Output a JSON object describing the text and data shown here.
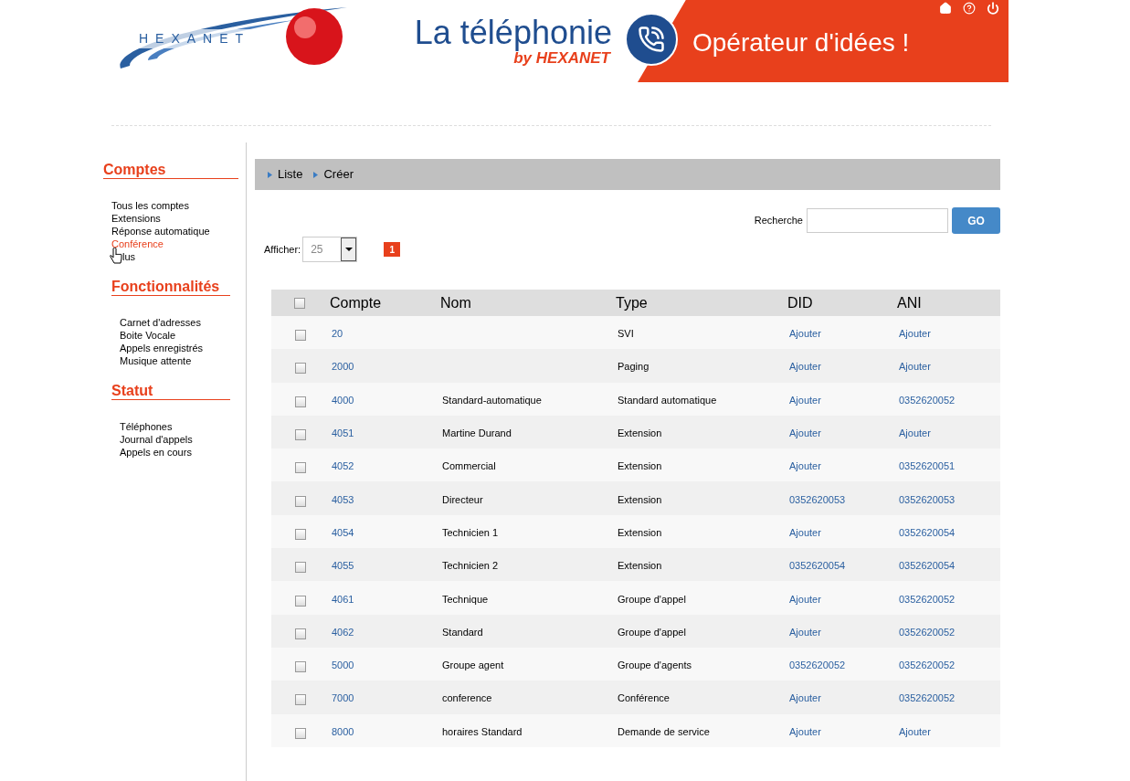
{
  "header": {
    "logo": "HEXANET",
    "banner_title": "La téléphonie",
    "banner_by": "by HEXANET",
    "banner_slogan": "Opérateur d'idées !"
  },
  "sidebar": {
    "sections": [
      {
        "title": "Comptes",
        "items": [
          {
            "label": "Tous les comptes",
            "selected": false
          },
          {
            "label": "Extensions",
            "selected": false
          },
          {
            "label": "Réponse automatique",
            "selected": false
          },
          {
            "label": "Conférence",
            "selected": true
          },
          {
            "label": "lus",
            "selected": false,
            "cursor": true
          }
        ]
      },
      {
        "title": "Fonctionnalités",
        "items": [
          {
            "label": "Carnet d'adresses",
            "selected": false
          },
          {
            "label": "Boite Vocale",
            "selected": false
          },
          {
            "label": "Appels enregistrés",
            "selected": false
          },
          {
            "label": "Musique attente",
            "selected": false
          }
        ]
      },
      {
        "title": "Statut",
        "items": [
          {
            "label": "Téléphones",
            "selected": false
          },
          {
            "label": "Journal d'appels",
            "selected": false
          },
          {
            "label": "Appels en cours",
            "selected": false
          }
        ]
      }
    ]
  },
  "toolbar": {
    "links": [
      "Liste",
      "Créer"
    ]
  },
  "search": {
    "label": "Recherche",
    "button": "GO"
  },
  "page_size": {
    "label": "Afficher:",
    "value": "25"
  },
  "pagination": {
    "pages": [
      {
        "label": "1",
        "selected": true
      }
    ]
  },
  "table": {
    "select_all_checked": false,
    "columns": [
      "Compte",
      "Nom",
      "Type",
      "DID",
      "ANI"
    ],
    "rows": [
      {
        "checked": false,
        "compte": "20",
        "nom": "",
        "type": "SVI",
        "did": "Ajouter",
        "ani": "Ajouter"
      },
      {
        "checked": false,
        "compte": "2000",
        "nom": "",
        "type": "Paging",
        "did": "Ajouter",
        "ani": "Ajouter"
      },
      {
        "checked": false,
        "compte": "4000",
        "nom": "Standard-automatique",
        "type": "Standard automatique",
        "did": "Ajouter",
        "ani": "0352620052"
      },
      {
        "checked": false,
        "compte": "4051",
        "nom": "Martine Durand",
        "type": "Extension",
        "did": "Ajouter",
        "ani": "Ajouter"
      },
      {
        "checked": false,
        "compte": "4052",
        "nom": "Commercial",
        "type": "Extension",
        "did": "Ajouter",
        "ani": "0352620051"
      },
      {
        "checked": false,
        "compte": "4053",
        "nom": "Directeur",
        "type": "Extension",
        "did": "0352620053",
        "ani": "0352620053"
      },
      {
        "checked": false,
        "compte": "4054",
        "nom": "Technicien 1",
        "type": "Extension",
        "did": "Ajouter",
        "ani": "0352620054"
      },
      {
        "checked": false,
        "compte": "4055",
        "nom": "Technicien 2",
        "type": "Extension",
        "did": "0352620054",
        "ani": "0352620054"
      },
      {
        "checked": false,
        "compte": "4061",
        "nom": "Technique",
        "type": "Groupe d'appel",
        "did": "Ajouter",
        "ani": "0352620052"
      },
      {
        "checked": false,
        "compte": "4062",
        "nom": "Standard",
        "type": "Groupe d'appel",
        "did": "Ajouter",
        "ani": "0352620052"
      },
      {
        "checked": false,
        "compte": "5000",
        "nom": "Groupe agent",
        "type": "Groupe d'agents",
        "did": "0352620052",
        "ani": "0352620052"
      },
      {
        "checked": false,
        "compte": "7000",
        "nom": "conference",
        "type": "Conférence",
        "did": "Ajouter",
        "ani": "0352620052"
      },
      {
        "checked": false,
        "compte": "8000",
        "nom": "horaires Standard",
        "type": "Demande de service",
        "did": "Ajouter",
        "ani": "Ajouter"
      }
    ]
  }
}
